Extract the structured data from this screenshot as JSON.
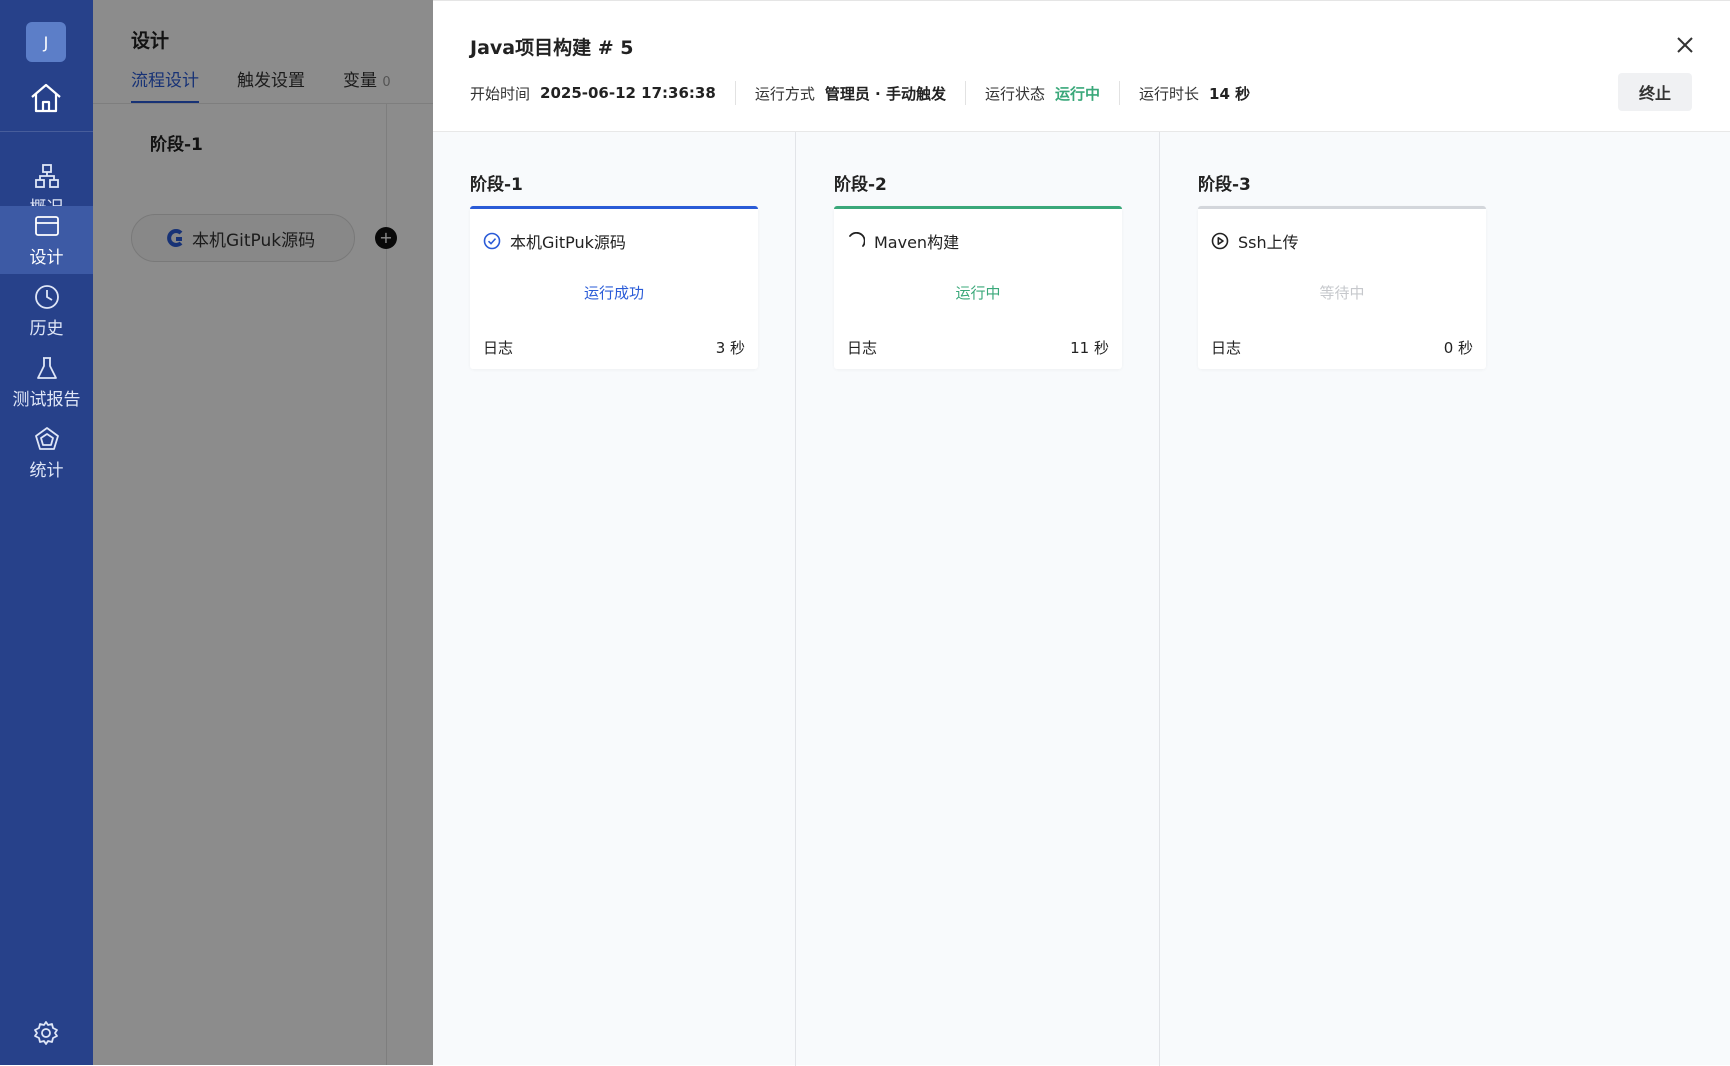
{
  "sidebar": {
    "avatar_letter": "J",
    "items": [
      {
        "label": "概况"
      },
      {
        "label": "设计"
      },
      {
        "label": "历史"
      },
      {
        "label": "测试报告"
      },
      {
        "label": "统计"
      }
    ],
    "active_index": 1,
    "bg_color": "#27418a"
  },
  "background_page": {
    "title": "设计",
    "tabs": [
      {
        "label": "流程设计"
      },
      {
        "label": "触发设置"
      },
      {
        "label": "变量",
        "count": "0"
      }
    ],
    "stage_label": "阶段-1",
    "task_label": "本机GitPuk源码",
    "add_symbol": "+"
  },
  "drawer": {
    "title": "Java项目构建 # 5",
    "meta": {
      "start_time_label": "开始时间",
      "start_time_value": "2025-06-12 17:36:38",
      "run_mode_label": "运行方式",
      "run_mode_value": "管理员 · 手动触发",
      "run_status_label": "运行状态",
      "run_status_value": "运行中",
      "duration_label": "运行时长",
      "duration_value": "14 秒"
    },
    "stop_label": "终止",
    "stages": [
      {
        "title": "阶段-1",
        "task": {
          "name": "本机GitPuk源码",
          "status": "运行成功",
          "log_label": "日志",
          "time": "3 秒",
          "state": "success",
          "icon": "check-circle-icon"
        }
      },
      {
        "title": "阶段-2",
        "task": {
          "name": "Maven构建",
          "status": "运行中",
          "log_label": "日志",
          "time": "11 秒",
          "state": "running",
          "icon": "spinner-icon"
        }
      },
      {
        "title": "阶段-3",
        "task": {
          "name": "Ssh上传",
          "status": "等待中",
          "log_label": "日志",
          "time": "0 秒",
          "state": "waiting",
          "icon": "play-circle-icon"
        }
      }
    ]
  },
  "colors": {
    "primary": "#2a5bd7",
    "success_green": "#3aa87a",
    "waiting_grey": "#c6c8cc"
  }
}
